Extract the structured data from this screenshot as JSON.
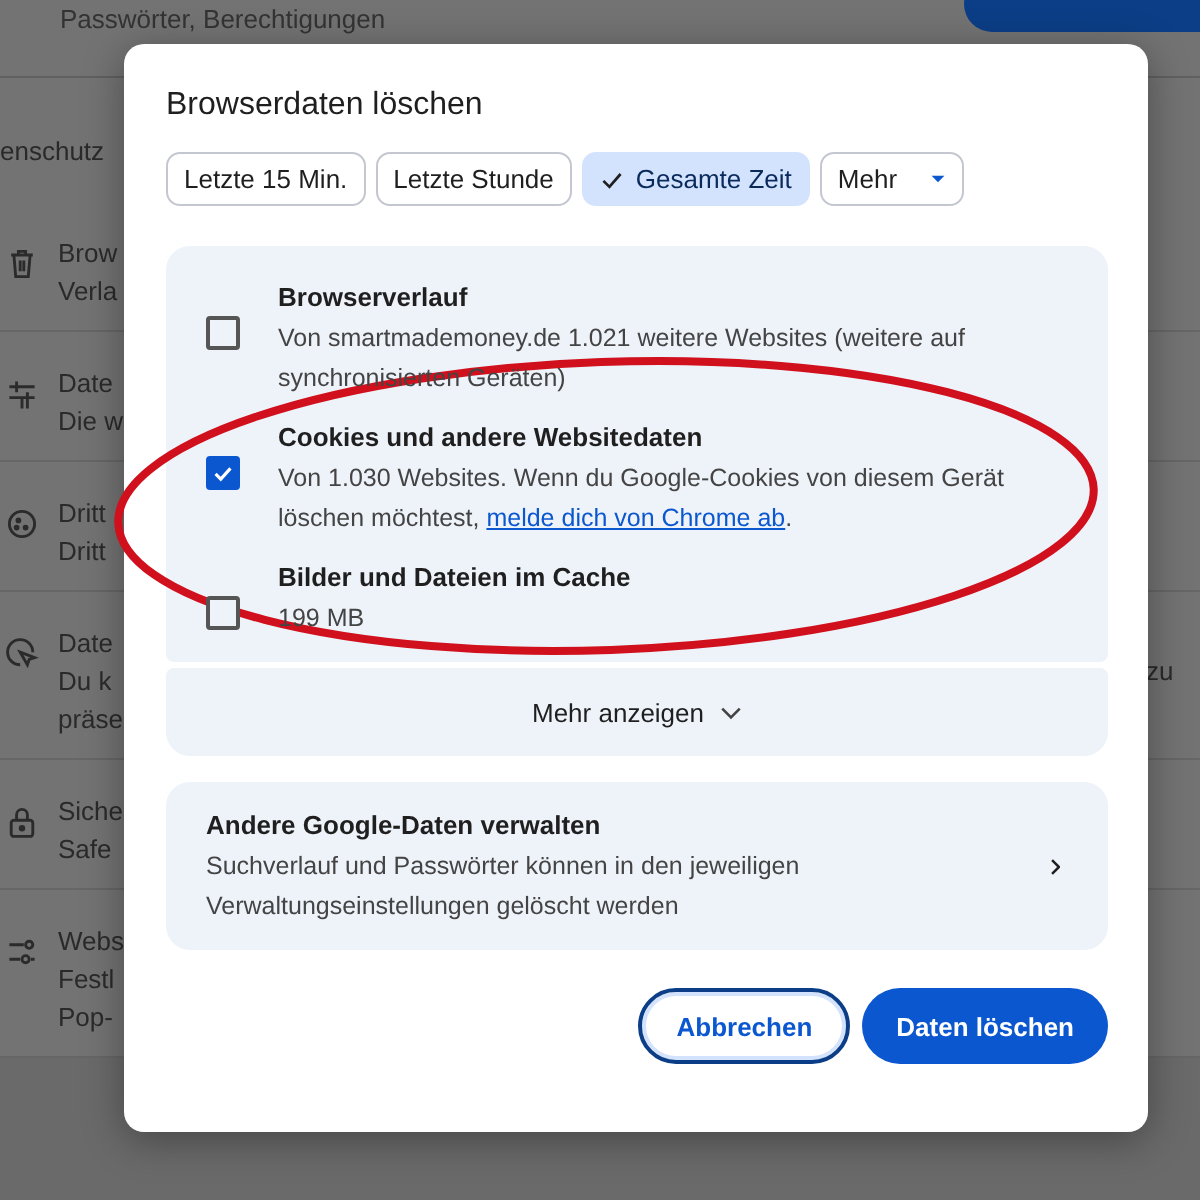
{
  "background": {
    "header_subtitle": "Passwörter, Berechtigungen",
    "section_label": "enschutz",
    "right_fragment": "zu",
    "rows": [
      {
        "lines": [
          "Brow",
          "Verla"
        ]
      },
      {
        "lines": [
          "Date",
          "Die w"
        ]
      },
      {
        "lines": [
          "Dritt",
          "Dritt"
        ]
      },
      {
        "lines": [
          "Date",
          "Du k",
          "präse"
        ]
      },
      {
        "lines": [
          "Siche",
          "Safe"
        ]
      },
      {
        "lines": [
          "Webs",
          "Festl",
          "Pop-"
        ]
      }
    ]
  },
  "dialog": {
    "title": "Browserdaten löschen",
    "time_ranges": [
      {
        "label": "Letzte 15 Min.",
        "selected": false,
        "kind": "chip"
      },
      {
        "label": "Letzte Stunde",
        "selected": false,
        "kind": "chip"
      },
      {
        "label": "Gesamte Zeit",
        "selected": true,
        "kind": "chip"
      },
      {
        "label": "Mehr",
        "selected": false,
        "kind": "dropdown"
      }
    ],
    "items": [
      {
        "title": "Browserverlauf",
        "description": "Von smartmademoney.de 1.021 weitere Websites (weitere auf synchronisierten Geräten)",
        "checked": false
      },
      {
        "title": "Cookies und andere Websitedaten",
        "description": "Von 1.030 Websites. Wenn du Google-Cookies von diesem Gerät löschen möchtest, ",
        "link": "melde dich von Chrome ab",
        "after_link": ".",
        "checked": true
      },
      {
        "title": "Bilder und Dateien im Cache",
        "description": "199 MB",
        "checked": false
      }
    ],
    "more_label": "Mehr anzeigen",
    "google_data": {
      "title": "Andere Google-Daten verwalten",
      "description": "Suchverlauf und Passwörter können in den jeweiligen Verwaltungseinstellungen gelöscht werden"
    },
    "buttons": [
      {
        "label": "Abbrechen",
        "kind": "secondary"
      },
      {
        "label": "Daten löschen",
        "kind": "primary"
      }
    ]
  }
}
